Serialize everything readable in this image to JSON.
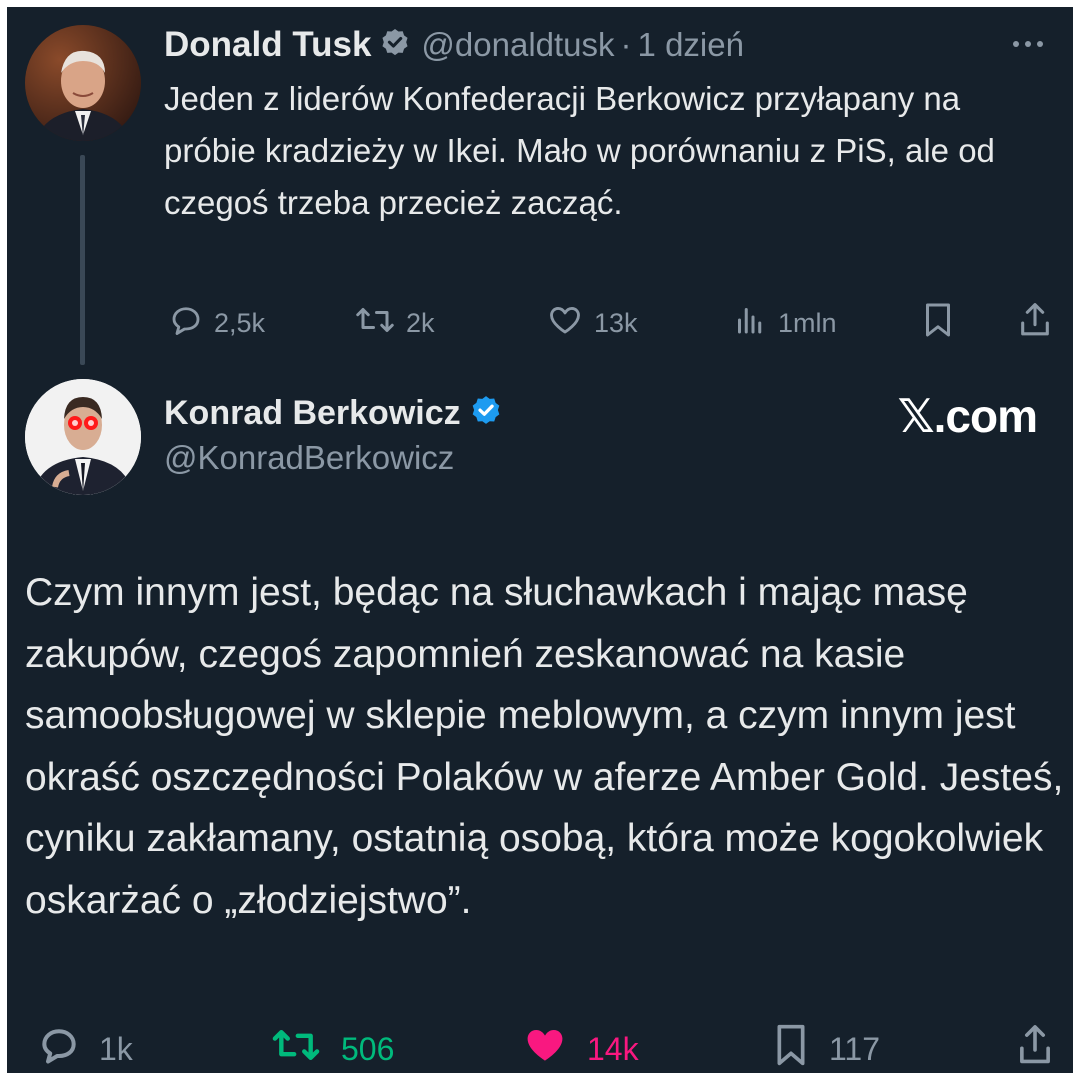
{
  "parent_tweet": {
    "author_name": "Donald Tusk",
    "handle": "@donaldtusk",
    "separator": "·",
    "time": "1 dzień",
    "text": "Jeden z liderów Konfederacji Berkowicz przyłapany na próbie kradzieży w Ikei. Mało w porównaniu z PiS, ale od czegoś trzeba przecież zacząć.",
    "verified_badge_color": "#8b98a5",
    "actions": {
      "replies": "2,5k",
      "retweets": "2k",
      "likes": "13k",
      "views": "1mln"
    }
  },
  "main_tweet": {
    "author_name": "Konrad Berkowicz",
    "handle": "@KonradBerkowicz",
    "verified_badge_color": "#1d9bf0",
    "watermark": "𝕏.com",
    "text": "Czym innym jest, będąc na słuchawkach i mając masę zakupów, czegoś zapomnień zeskanować na kasie samoobsługowej w sklepie meblowym, a czym innym jest okraść oszczędności Polaków w aferze Amber Gold. Jesteś, cyniku zakłamany, ostatnią osobą, która może kogokolwiek oskarżać o „złodziejstwo”.",
    "actions": {
      "replies": "1k",
      "retweets": "506",
      "likes": "14k",
      "bookmarks": "117"
    },
    "colors": {
      "retweet_active": "#00ba7c",
      "like_active": "#f91880",
      "muted": "#8b98a5"
    }
  }
}
